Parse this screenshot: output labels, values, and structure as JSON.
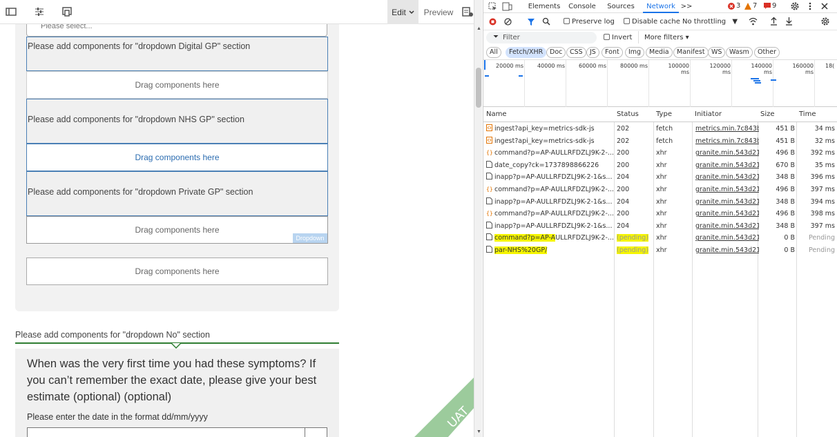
{
  "left": {
    "edit_label": "Edit",
    "preview_label": "Preview",
    "select_placeholder": "Please select...",
    "sections": [
      {
        "heading": "Please add components for \"dropdown Digital GP\" section",
        "drop": "Drag components here"
      },
      {
        "heading": "Please add components for \"dropdown NHS GP\" section",
        "drop": "Drag components here"
      },
      {
        "heading": "Please add components for \"dropdown Private GP\" section",
        "drop": "Drag components here",
        "tag": "Dropdown"
      }
    ],
    "outer_drop": "Drag components here",
    "no_section": "Please add components for \"dropdown No\" section",
    "question": "When was the very first time you had these symptoms? If you can’t remember the exact date, please give your best estimate (optional) (optional)",
    "hint": "Please enter the date in the format dd/mm/yyyy",
    "watermark": "UAT"
  },
  "devtools": {
    "tabs": [
      "Elements",
      "Console",
      "Sources",
      "Network"
    ],
    "active_tab": "Network",
    "more": ">>",
    "errors": "3",
    "warnings": "7",
    "issues": "9",
    "preserve_log": "Preserve log",
    "disable_cache": "Disable cache",
    "throttling": "No throttling",
    "filter_placeholder": "Filter",
    "invert": "Invert",
    "more_filters": "More filters",
    "type_filters": [
      "All",
      "Fetch/XHR",
      "Doc",
      "CSS",
      "JS",
      "Font",
      "Img",
      "Media",
      "Manifest",
      "WS",
      "Wasm",
      "Other"
    ],
    "active_filter": "Fetch/XHR",
    "timeline_ticks": [
      "20000 ms",
      "40000 ms",
      "60000 ms",
      "80000 ms",
      "100000 ms",
      "120000 ms",
      "140000 ms",
      "160000 ms",
      "18("
    ],
    "columns": [
      "Name",
      "Status",
      "Type",
      "Initiator",
      "Size",
      "Time"
    ],
    "rows": [
      {
        "icon": "fetch",
        "name": "ingest?api_key=metrics-sdk-js",
        "status": "202",
        "type": "fetch",
        "initiator": "metrics.min.7c843ba",
        "size": "451 B",
        "time": "34 ms"
      },
      {
        "icon": "fetch",
        "name": "ingest?api_key=metrics-sdk-js",
        "status": "202",
        "type": "fetch",
        "initiator": "metrics.min.7c843ba",
        "size": "451 B",
        "time": "32 ms"
      },
      {
        "icon": "xhr-json",
        "name": "command?p=AP-AULLRFDZLJ9K-2-...",
        "status": "200",
        "type": "xhr",
        "initiator": "granite.min.543d214",
        "size": "496 B",
        "time": "392 ms"
      },
      {
        "icon": "doc",
        "name": "date_copy?ck=1737898866226",
        "status": "200",
        "type": "xhr",
        "initiator": "granite.min.543d214",
        "size": "670 B",
        "time": "35 ms"
      },
      {
        "icon": "doc",
        "name": "inapp?p=AP-AULLRFDZLJ9K-2-1&s...",
        "status": "204",
        "type": "xhr",
        "initiator": "granite.min.543d214",
        "size": "348 B",
        "time": "396 ms"
      },
      {
        "icon": "xhr-json",
        "name": "command?p=AP-AULLRFDZLJ9K-2-...",
        "status": "200",
        "type": "xhr",
        "initiator": "granite.min.543d214",
        "size": "496 B",
        "time": "397 ms"
      },
      {
        "icon": "doc",
        "name": "inapp?p=AP-AULLRFDZLJ9K-2-1&s...",
        "status": "204",
        "type": "xhr",
        "initiator": "granite.min.543d214",
        "size": "348 B",
        "time": "394 ms"
      },
      {
        "icon": "xhr-json",
        "name": "command?p=AP-AULLRFDZLJ9K-2-...",
        "status": "200",
        "type": "xhr",
        "initiator": "granite.min.543d214",
        "size": "496 B",
        "time": "398 ms"
      },
      {
        "icon": "doc",
        "name": "inapp?p=AP-AULLRFDZLJ9K-2-1&s...",
        "status": "204",
        "type": "xhr",
        "initiator": "granite.min.543d214",
        "size": "348 B",
        "time": "397 ms"
      },
      {
        "icon": "doc",
        "name": "command?p=AP-AULLRFDZLJ9K-2-...",
        "status": "(pending)",
        "type": "xhr",
        "initiator": "granite.min.543d214",
        "size": "0 B",
        "time": "Pending",
        "highlight": true,
        "highlight_prefix": "command?p=AP-A",
        "rest": "ULLRFDZLJ9K-2-..."
      },
      {
        "icon": "doc",
        "name": "par-NHS%20GP/",
        "status": "(pending)",
        "type": "xhr",
        "initiator": "granite.min.543d214",
        "size": "0 B",
        "time": "Pending",
        "highlight": true,
        "highlight_prefix": "par-NHS%20GP/",
        "rest": ""
      }
    ],
    "colors": {
      "accent": "#1a73e8",
      "error": "#d93025",
      "warning": "#e37400",
      "highlight": "#f5f500"
    }
  }
}
